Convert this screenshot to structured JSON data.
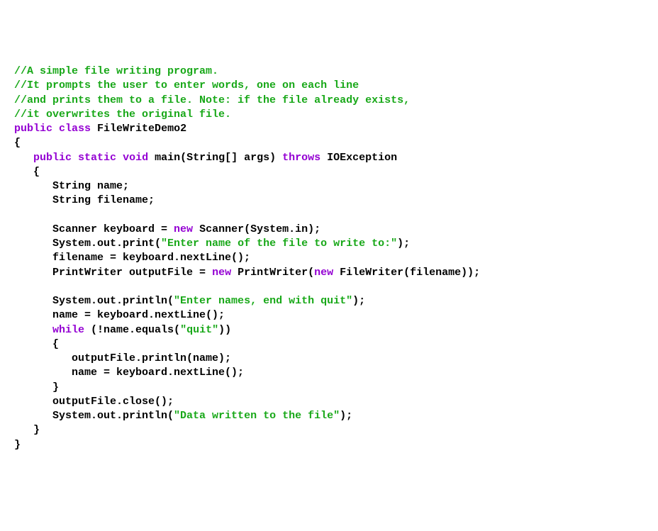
{
  "code": {
    "c1": "//A simple file writing program.",
    "c2": "//It prompts the user to enter words, one on each line",
    "c3": "//and prints them to a file. Note: if the file already exists,",
    "c4": "//it overwrites the original file.",
    "kw_public": "public",
    "kw_class": "class",
    "class_name": " FileWriteDemo2",
    "brace_open": "{",
    "indent1": "   ",
    "kw_static": "static",
    "kw_void": "void",
    "main_sig": " main(String[] args) ",
    "kw_throws": "throws",
    "ioexception": " IOException",
    "indent2": "      ",
    "decl_name": "String name;",
    "decl_filename": "String filename;",
    "scanner_part1": "Scanner keyboard = ",
    "kw_new": "new",
    "scanner_part2": " Scanner(System.in);",
    "sysout_print1": "System.out.print(",
    "str_prompt1": "\"Enter name of the file to write to:\"",
    "close_paren_semi": ");",
    "filename_assign": "filename = keyboard.nextLine();",
    "pw_part1": "PrintWriter outputFile = ",
    "pw_part2": " PrintWriter(",
    "pw_part3": " FileWriter(filename));",
    "sysout_println": "System.out.println(",
    "str_prompt2": "\"Enter names, end with quit\"",
    "name_assign": "name = keyboard.nextLine();",
    "kw_while": "while",
    "while_cond1": " (!name.equals(",
    "str_quit": "\"quit\"",
    "while_cond2": "))",
    "indent3": "         ",
    "output_println": "outputFile.println(name);",
    "brace_close": "}",
    "output_close": "outputFile.close();",
    "str_written": "\"Data written to the file\"",
    "space": " "
  }
}
